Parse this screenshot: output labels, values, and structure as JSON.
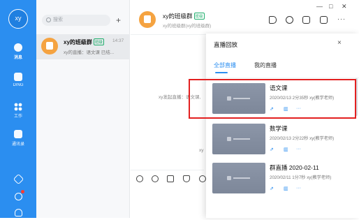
{
  "rail": {
    "avatar_text": "xy",
    "items": [
      {
        "label": "消息",
        "icon": "chat-bubble-icon"
      },
      {
        "label": "DING",
        "icon": "ding-icon"
      },
      {
        "label": "工作",
        "icon": "workspace-grid-icon"
      },
      {
        "label": "通讯录",
        "icon": "contacts-icon"
      }
    ],
    "bottom_icons": [
      "cube-icon",
      "phone-icon",
      "cloud-icon"
    ]
  },
  "conversation_list": {
    "search_placeholder": "搜索",
    "add_button": "+",
    "items": [
      {
        "name": "xy的班级群",
        "badge": "班级",
        "time": "14:37",
        "preview": "xy的直播：语文课 已结..."
      }
    ]
  },
  "chat": {
    "title": "xy的班级群",
    "badge": "班级",
    "subtitle": "xy的班级群(xy的班级群)",
    "window_controls": [
      "—",
      "□",
      "✕"
    ],
    "header_icons": [
      "megaphone-icon",
      "history-icon",
      "folder-icon",
      "live-icon"
    ],
    "more": "···",
    "system_message": "xy发起直播：语文课,",
    "system_message_2": "xy",
    "toolbar_icons": [
      "gif-icon",
      "emoji-icon",
      "thumbs-up-icon",
      "scissors-icon",
      "at-icon"
    ]
  },
  "live_panel": {
    "title": "直播回放",
    "close": "×",
    "tabs": [
      "全部直播",
      "我的直播"
    ],
    "active_tab": 0,
    "records": [
      {
        "title": "语文课",
        "meta": "2020/02/13 2分35秒 xy(教学老师)",
        "actions": [
          "share-icon",
          "stats-icon",
          "more-icon"
        ]
      },
      {
        "title": "数学课",
        "meta": "2020/02/13 2分22秒 xy(教学老师)",
        "actions": [
          "share-icon",
          "stats-icon",
          "more-icon"
        ]
      },
      {
        "title": "群直播 2020-02-11",
        "meta": "2020/02/11 1分7秒 xy(教学老师)",
        "actions": [
          "share-icon",
          "stats-icon",
          "more-icon"
        ]
      }
    ]
  },
  "colors": {
    "primary": "#2b8ef0",
    "highlight": "#e32020",
    "class_badge": "#1fae6c"
  }
}
